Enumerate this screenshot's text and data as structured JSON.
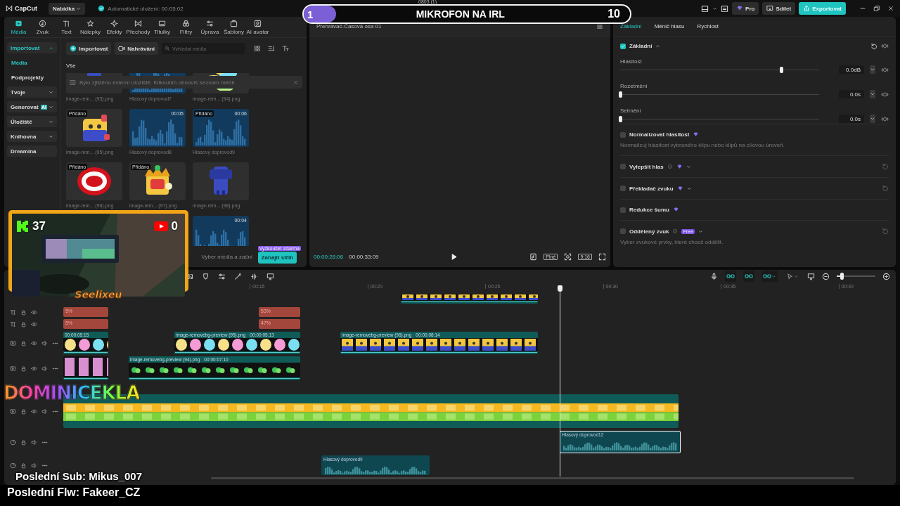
{
  "title_bar": {
    "app_name": "CapCut",
    "menu": "Nabídka",
    "autosave": "Automatické uložení: 00:05:02",
    "project_title": "0803 (1)",
    "buttons": [
      {
        "label": "Pro",
        "kind": "pro"
      },
      {
        "label": "Sdílet",
        "kind": "share"
      },
      {
        "label": "Exportovat",
        "kind": "export"
      }
    ]
  },
  "toolbar": {
    "tabs": [
      {
        "label": "Média",
        "selected": true
      },
      {
        "label": "Zvuk",
        "selected": false
      },
      {
        "label": "Text",
        "selected": false
      },
      {
        "label": "Nálepky",
        "selected": false
      },
      {
        "label": "Efekty",
        "selected": false
      },
      {
        "label": "Přechody",
        "selected": false
      },
      {
        "label": "Titulky",
        "selected": false
      },
      {
        "label": "Filtry",
        "selected": false
      },
      {
        "label": "Úprava",
        "selected": false
      },
      {
        "label": "Šablony",
        "selected": false
      },
      {
        "label": "AI avatar",
        "selected": false
      }
    ]
  },
  "media_sidebar": {
    "items": [
      {
        "label": "Importovat",
        "kind": "group",
        "expanded": true,
        "selected": true
      },
      {
        "label": "Média",
        "kind": "sub",
        "selected": true
      },
      {
        "label": "Podprojekty",
        "kind": "sub",
        "selected": false
      },
      {
        "label": "Tvoje",
        "kind": "group",
        "expanded": false,
        "selected": false
      },
      {
        "label": "Generovat",
        "kind": "group",
        "expanded": false,
        "selected": false,
        "badge": "AI"
      },
      {
        "label": "Úložiště",
        "kind": "group",
        "expanded": false,
        "selected": false
      },
      {
        "label": "Knihovna",
        "kind": "group",
        "expanded": false,
        "selected": false
      },
      {
        "label": "Dreamina",
        "kind": "plain",
        "selected": false
      }
    ]
  },
  "media": {
    "buttons": [
      {
        "label": "Importovat",
        "kind": "import"
      },
      {
        "label": "Nahrávání",
        "kind": "record"
      }
    ],
    "search": {
      "placeholder": "Vyhledat média"
    },
    "filter": "Vše",
    "notice": "Bylo zjištěno externí úložiště. Kliknutím obnovíš seznam médií.",
    "items": [
      {
        "label": "image-rem... (93).png"
      },
      {
        "kind": "audio",
        "label": "Hlasový doprovod7"
      },
      {
        "label": "image-rem... (94).png"
      },
      {
        "label": "image-rem... (95).png",
        "tag": "Přidáno"
      },
      {
        "kind": "audio",
        "label": "Hlasový doprovod8",
        "duration": "00:05"
      },
      {
        "kind": "audio",
        "label": "Hlasový doprovod9",
        "tag": "Přidáno",
        "duration": "00:06"
      },
      {
        "label": "image-rem... (96).png",
        "tag": "Přidáno"
      },
      {
        "label": "image-rem... (97).png",
        "tag": "Přidáno"
      },
      {
        "label": "image-rem... (98).png"
      },
      {
        "kind": "audio",
        "duration": "00:04"
      }
    ],
    "footer_hint": "Vyber média a začni",
    "start_button": "Zahájit střih",
    "start_badge": "Vyzkoušet zdarma"
  },
  "player": {
    "title": "Přehrávač-Časová osa 01",
    "current_time": "00:00:28:06",
    "total_time": "00:00:33:09",
    "buttons": [
      "Plné",
      "9:16"
    ]
  },
  "inspector": {
    "tabs": [
      {
        "label": "Základní",
        "selected": true
      },
      {
        "label": "Měnič hlasu",
        "selected": false
      },
      {
        "label": "Rychlost",
        "selected": false
      }
    ],
    "section": {
      "label": "Základní",
      "checked": true
    },
    "sliders": [
      {
        "label": "Hlasitost",
        "level": 0.81,
        "value": "0.0dB"
      },
      {
        "label": "Rozetmění",
        "level": 0,
        "value": "0.0s"
      },
      {
        "label": "Setmění",
        "level": 0,
        "value": "0.0s"
      }
    ],
    "options": [
      {
        "label": "Normalizovat hlasitost",
        "checked": false,
        "pro": true,
        "description": "Normalizuj hlasitost vybraného klipu nebo klipů na cílovou úroveň."
      },
      {
        "label": "Vylepšit hlas",
        "checked": false,
        "pro": true,
        "info": true,
        "dropdown": true,
        "reset": true
      },
      {
        "label": "Překladač zvuku",
        "checked": false,
        "pro": true,
        "dropdown": true,
        "reset": true
      },
      {
        "label": "Redukce šumu",
        "checked": false,
        "pro": true
      },
      {
        "label": "Oddělený zvuk",
        "checked": false,
        "info": true,
        "dropdown": true,
        "reset": true,
        "badge": "Free",
        "description": "Vyber zvukové prvky, které chceš oddělit."
      }
    ]
  },
  "timeline": {
    "toggles": [
      {
        "on": true
      },
      {
        "on": true
      },
      {
        "on": true
      }
    ],
    "zoom": {
      "level": 0.12
    },
    "ruler": [
      "00:15",
      "00:20",
      "00:25",
      "00:30",
      "00:35",
      "00:40"
    ],
    "tracks": [
      {
        "kind": "sticker",
        "clips": [
          {
            "kind": "picture"
          }
        ]
      },
      {
        "kind": "text",
        "clips": [
          {
            "label": "5%"
          },
          {
            "label": "53%"
          }
        ]
      },
      {
        "kind": "text",
        "clips": [
          {
            "label": "5%"
          },
          {
            "label": "47%"
          }
        ]
      },
      {
        "kind": "video",
        "clips": [
          {
            "duration": "00:00:05:15"
          },
          {
            "name": "image-removebg-preview (95).png",
            "duration": "00:00:05:13"
          },
          {
            "name": "image-removebg-preview (96).png",
            "duration": "00:00:08:14"
          }
        ]
      },
      {
        "kind": "video",
        "clips": [
          {
            "kind": "picture"
          },
          {
            "name": "image-removebg-preview (94).png",
            "duration": "00:00:07:10"
          }
        ]
      },
      {
        "kind": "main",
        "clips": [
          {
            "kind": "picture"
          }
        ]
      },
      {
        "kind": "audio",
        "clips": [
          {
            "name": "Hlasový doprovod12",
            "selected": true
          }
        ]
      },
      {
        "kind": "audio",
        "clips": [
          {
            "name": "Hlasový doprovod9",
            "selected": false
          }
        ]
      }
    ]
  },
  "overlays": {
    "goal": {
      "current": "1",
      "title": "MIKROFON NA IRL",
      "target": "10",
      "level": 0.1
    },
    "webcam": {
      "kick_count": "37",
      "youtube_count": "0",
      "name": "Seelixeu"
    },
    "logo": "DOMINICEKLA",
    "last_sub": "Poslední Sub: Mikus_007",
    "last_follow": "Poslední Flw: Fakeer_CZ"
  }
}
